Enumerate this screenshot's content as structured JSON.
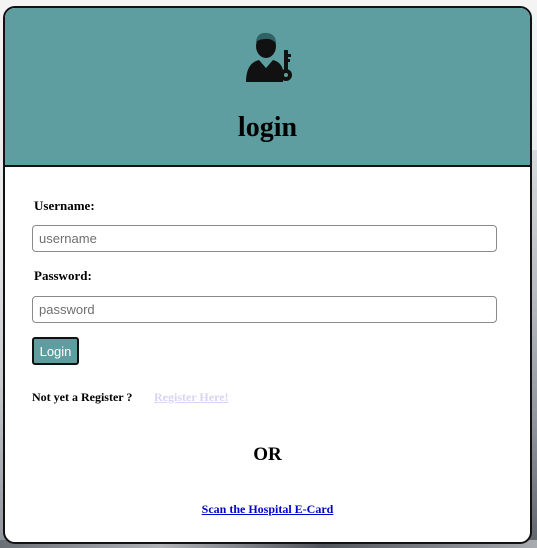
{
  "header": {
    "title": "login",
    "avatar_icon": "user-with-key-icon",
    "background_color": "#5f9ea0"
  },
  "form": {
    "username_label": "Username:",
    "username_placeholder": "username",
    "username_value": "",
    "password_label": "Password:",
    "password_placeholder": "password",
    "password_value": "",
    "login_button": "Login"
  },
  "register": {
    "prompt": "Not yet a Register ?",
    "link_text": "Register Here!"
  },
  "alternate": {
    "or_text": "OR",
    "ecard_link": "Scan the Hospital E-Card"
  }
}
